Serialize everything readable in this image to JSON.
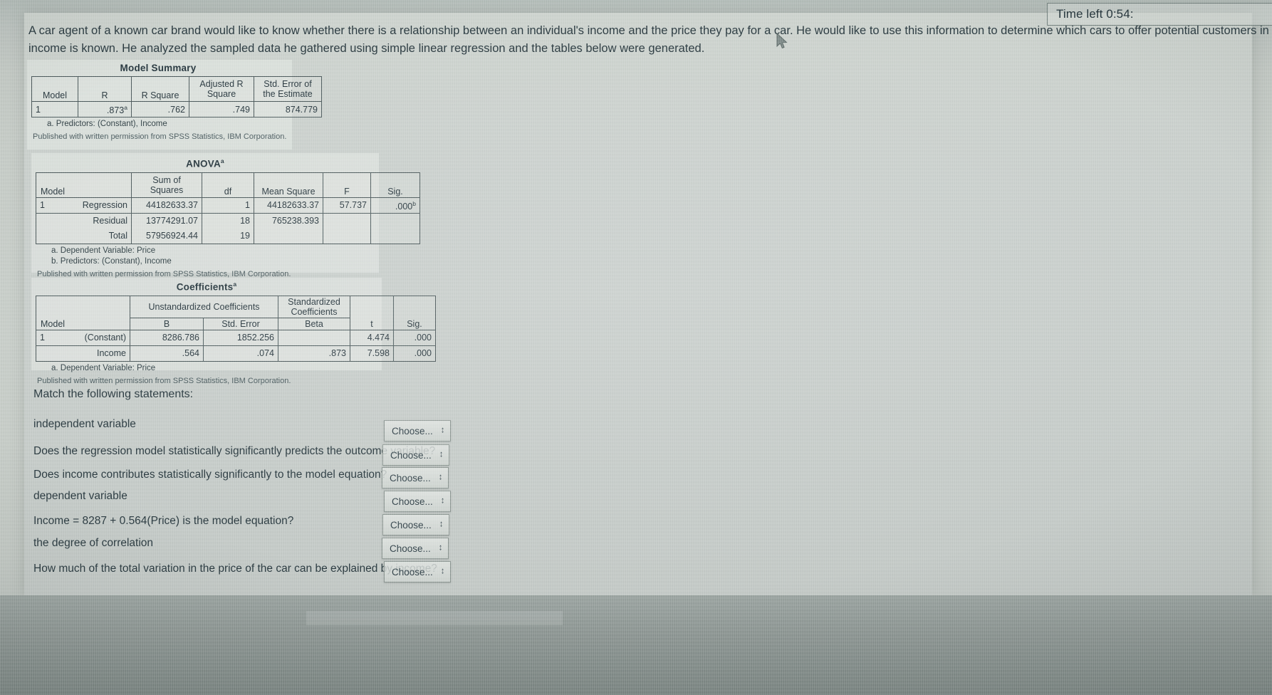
{
  "timer": {
    "label": "Time left 0:54:"
  },
  "intro": {
    "line1": "A car agent of a known car brand would like to know whether there is a relationship between an individual's income and the price they pay for a car. He would like to use this information to determine which cars to offer potential customers in new areas where",
    "line2": "income is known. He analyzed the sampled data he gathered using simple linear regression and the tables below were generated."
  },
  "model_summary": {
    "title": "Model Summary",
    "headers": [
      "Model",
      "R",
      "R Square",
      "Adjusted R Square",
      "Std. Error of the Estimate"
    ],
    "header_r": "R",
    "header_rsq": "R Square",
    "header_adj_line1": "Adjusted R",
    "header_adj_line2": "Square",
    "header_se_line1": "Std. Error of",
    "header_se_line2": "the Estimate",
    "header_model": "Model",
    "rows": [
      {
        "model": "1",
        "r": ".873",
        "r_sup": "a",
        "r_square": ".762",
        "adj_r_square": ".749",
        "std_error": "874.779"
      }
    ],
    "footnote_a": "a. Predictors: (Constant), Income",
    "published": "Published with written permission from SPSS Statistics, IBM Corporation."
  },
  "anova": {
    "title": "ANOVA",
    "title_sup": "a",
    "header_model": "Model",
    "header_ss_line1": "Sum of",
    "header_ss_line2": "Squares",
    "header_df": "df",
    "header_ms": "Mean Square",
    "header_f": "F",
    "header_sig": "Sig.",
    "rows": [
      {
        "model": "1",
        "source": "Regression",
        "sum_of_squares": "44182633.37",
        "df": "1",
        "mean_square": "44182633.37",
        "f": "57.737",
        "sig": ".000",
        "sig_sup": "b"
      },
      {
        "model": "",
        "source": "Residual",
        "sum_of_squares": "13774291.07",
        "df": "18",
        "mean_square": "765238.393",
        "f": "",
        "sig": "",
        "sig_sup": ""
      },
      {
        "model": "",
        "source": "Total",
        "sum_of_squares": "57956924.44",
        "df": "19",
        "mean_square": "",
        "f": "",
        "sig": "",
        "sig_sup": ""
      }
    ],
    "footnote_a": "a. Dependent Variable: Price",
    "footnote_b": "b. Predictors: (Constant), Income",
    "published": "Published with written permission from SPSS Statistics, IBM Corporation."
  },
  "coefficients": {
    "title": "Coefficients",
    "title_sup": "a",
    "header_model": "Model",
    "header_unstd": "Unstandardized Coefficients",
    "header_std_line1": "Standardized",
    "header_std_line2": "Coefficients",
    "header_b": "B",
    "header_se": "Std. Error",
    "header_beta": "Beta",
    "header_t": "t",
    "header_sig": "Sig.",
    "rows": [
      {
        "model": "1",
        "term": "(Constant)",
        "b": "8286.786",
        "std_error": "1852.256",
        "beta": "",
        "t": "4.474",
        "sig": ".000"
      },
      {
        "model": "",
        "term": "Income",
        "b": ".564",
        "std_error": ".074",
        "beta": ".873",
        "t": "7.598",
        "sig": ".000"
      }
    ],
    "footnote_a": "a. Dependent Variable: Price",
    "published": "Published with written permission from SPSS Statistics, IBM Corporation."
  },
  "match": {
    "instruction": "Match the following statements:",
    "dropdown_placeholder": "Choose...",
    "caret": "↕",
    "items": [
      {
        "statement": "independent variable"
      },
      {
        "statement": "Does the regression model statistically significantly predicts the outcome variable?"
      },
      {
        "statement": "Does income contributes statistically significantly to the model equation?"
      },
      {
        "statement": "dependent variable"
      },
      {
        "statement": "Income = 8287 + 0.564(Price) is the model equation?"
      },
      {
        "statement": "the degree of correlation"
      },
      {
        "statement": "How much of the total variation in the price of the car can be explained by income?"
      }
    ]
  }
}
